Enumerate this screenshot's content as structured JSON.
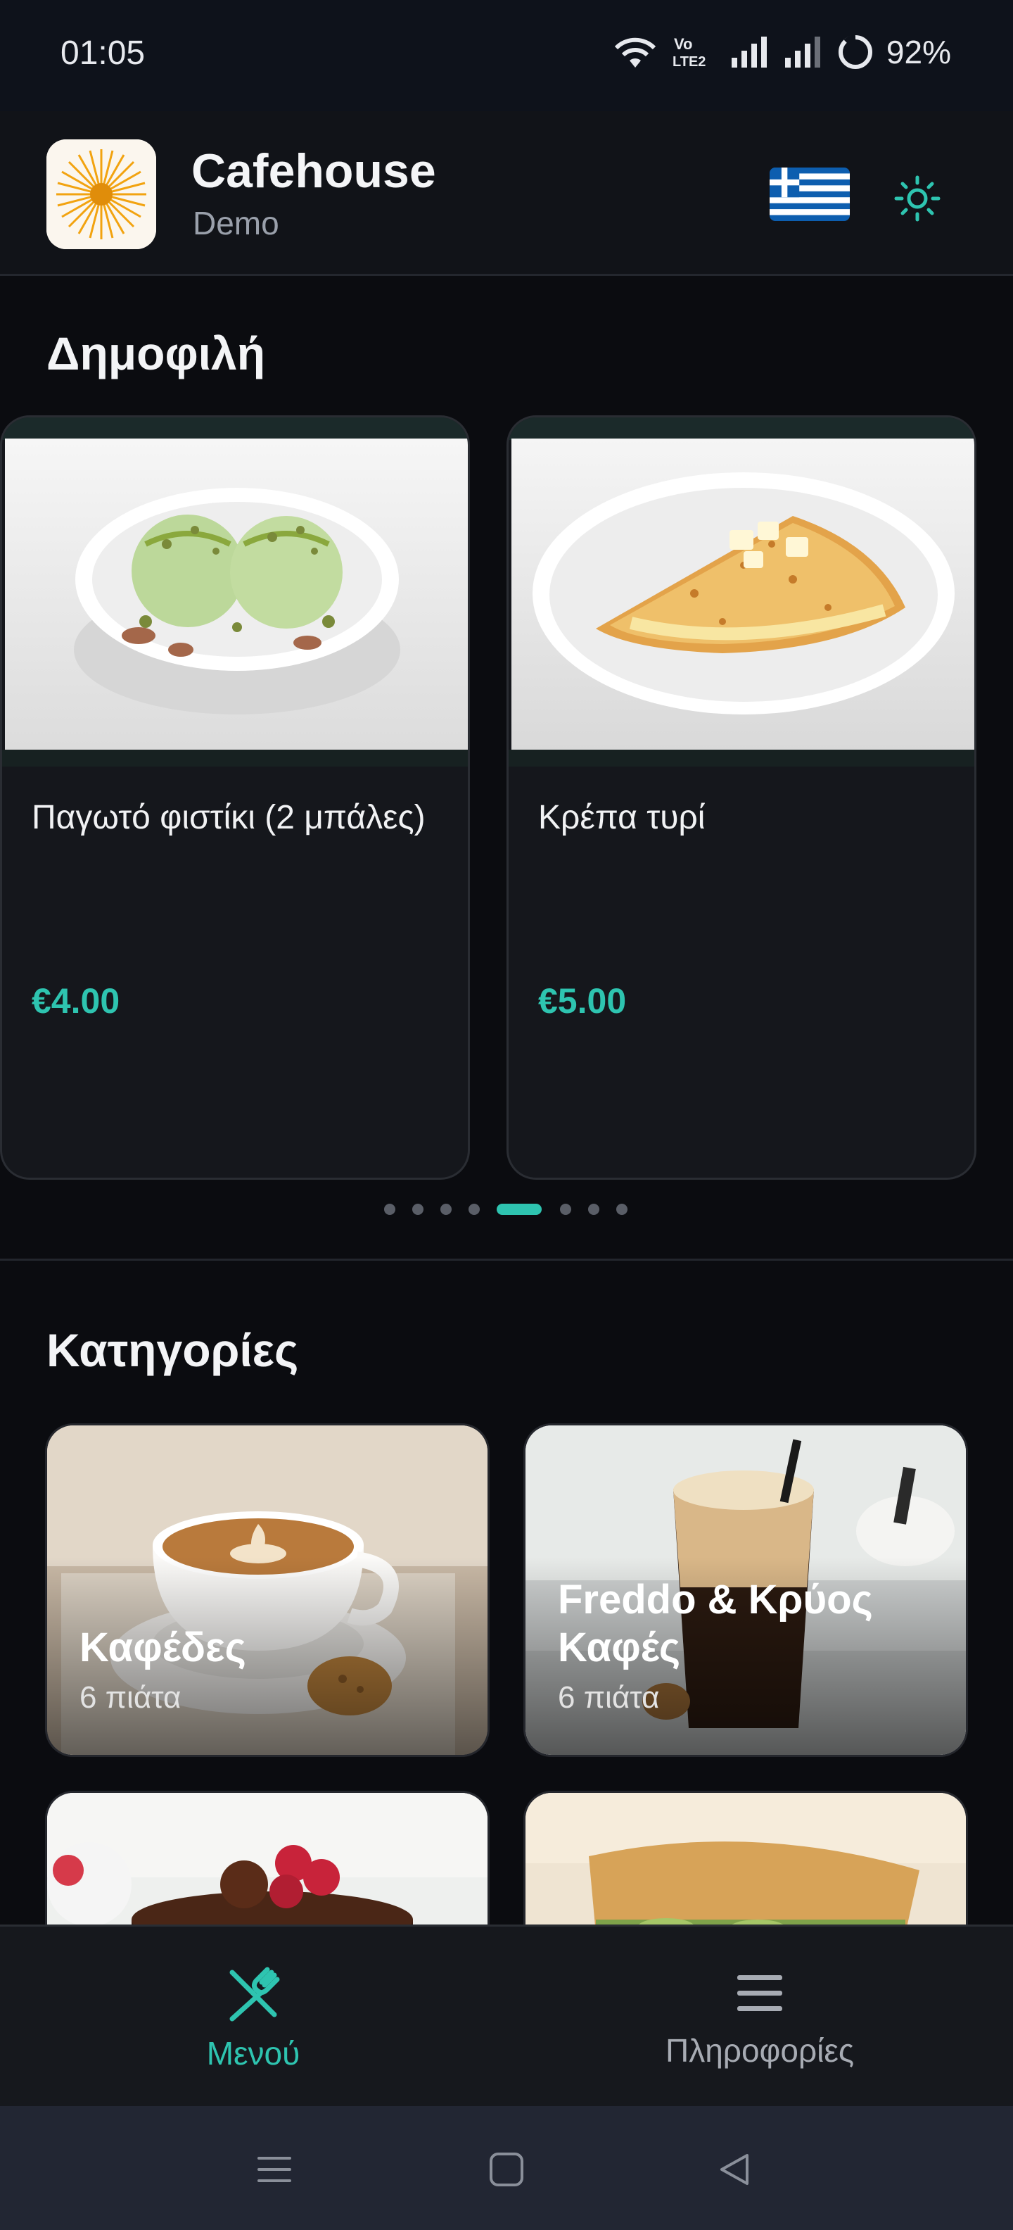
{
  "status_bar": {
    "time": "01:05",
    "battery": "92%",
    "icons": [
      "wifi-icon",
      "volte-icon",
      "signal-icon",
      "signal-icon",
      "battery-icon"
    ]
  },
  "header": {
    "app_name": "Cafehouse",
    "subtitle": "Demo",
    "language_flag": "greek-flag-icon",
    "theme_icon": "sun-icon"
  },
  "popular": {
    "title": "Δημοφιλή",
    "items": [
      {
        "name": "Παγωτό φιστίκι (2 μπάλες)",
        "price": "€4.00",
        "image": "pistachio-ice-cream"
      },
      {
        "name": "Κρέπα τυρί",
        "price": "€5.00",
        "image": "cheese-crepe"
      }
    ],
    "carousel": {
      "total": 8,
      "active_index": 4
    }
  },
  "categories": {
    "title": "Κατηγορίες",
    "items": [
      {
        "name": "Καφέδες",
        "count": "6 πιάτα"
      },
      {
        "name": "Freddo & Κρύος Καφές",
        "count": "6 πιάτα"
      },
      {
        "name": "",
        "count": ""
      },
      {
        "name": "",
        "count": ""
      }
    ]
  },
  "bottom_nav": {
    "items": [
      {
        "label": "Μενού",
        "icon": "fork-knife-icon",
        "active": true
      },
      {
        "label": "Πληροφορίες",
        "icon": "hamburger-menu-icon",
        "active": false
      }
    ]
  },
  "colors": {
    "accent": "#2ec4b0",
    "background": "#0b0c10",
    "card": "#15171c"
  }
}
